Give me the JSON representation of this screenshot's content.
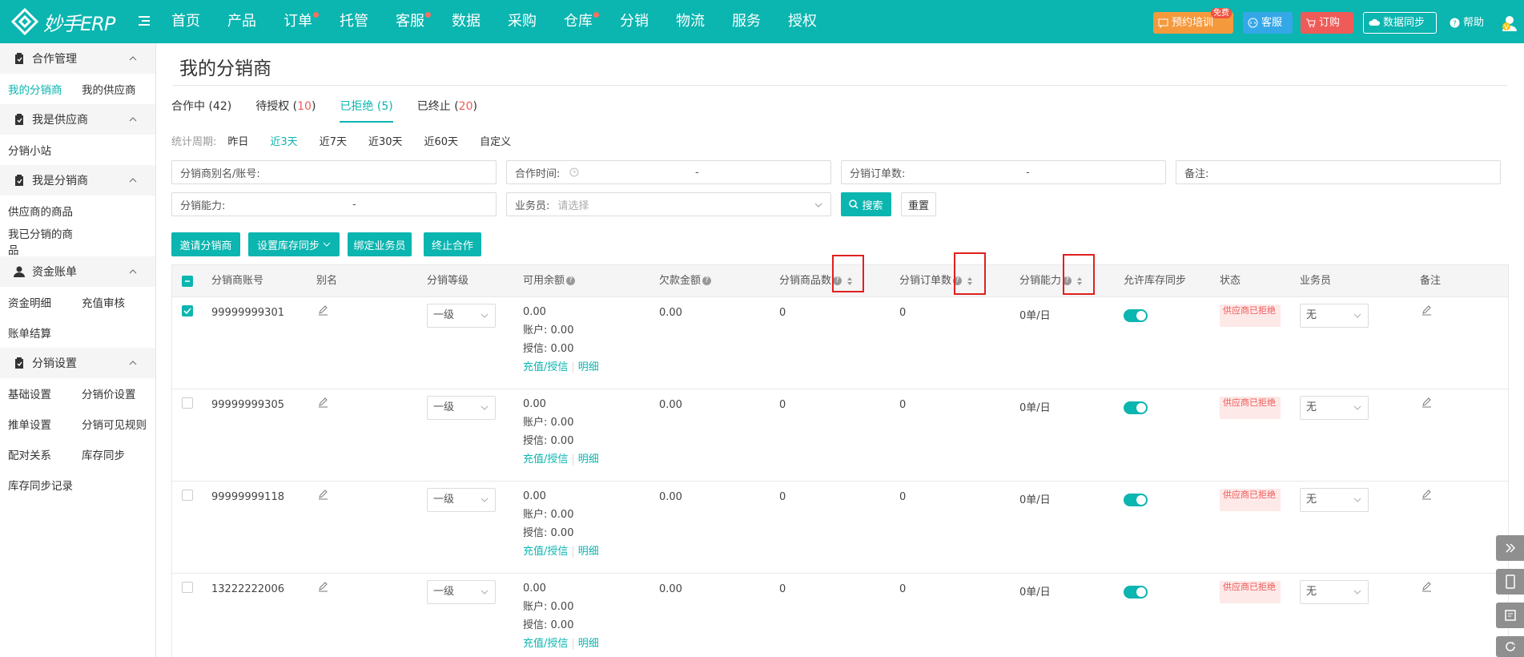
{
  "app": {
    "name": "妙手ERP",
    "brand_color": "#0bb5b0",
    "accent_red": "#ef5b58"
  },
  "nav": [
    {
      "label": "首页",
      "dot": false
    },
    {
      "label": "产品",
      "dot": false
    },
    {
      "label": "订单",
      "dot": true
    },
    {
      "label": "托管",
      "dot": false
    },
    {
      "label": "客服",
      "dot": true
    },
    {
      "label": "数据",
      "dot": false
    },
    {
      "label": "采购",
      "dot": false
    },
    {
      "label": "仓库",
      "dot": true
    },
    {
      "label": "分销",
      "dot": false
    },
    {
      "label": "物流",
      "dot": false
    },
    {
      "label": "服务",
      "dot": false
    },
    {
      "label": "授权",
      "dot": false
    }
  ],
  "topright": {
    "train": "预约培训",
    "free": "免费",
    "service": "客服",
    "buy": "订购",
    "sync": "数据同步",
    "help": "帮助",
    "avatar": "V"
  },
  "sidebar": {
    "groups": [
      {
        "title": "合作管理",
        "icon": "clipboard-icon",
        "rows": [
          [
            "我的分销商",
            "我的供应商"
          ]
        ]
      },
      {
        "title": "我是供应商",
        "icon": "clipboard-icon",
        "rows": [
          [
            "分销小站"
          ]
        ]
      },
      {
        "title": "我是分销商",
        "icon": "clipboard-icon",
        "rows": [
          [
            "供应商的商品"
          ],
          [
            "我已分销的商品"
          ]
        ]
      },
      {
        "title": "资金账单",
        "icon": "user-icon",
        "rows": [
          [
            "资金明细",
            "充值审核"
          ],
          [
            "账单结算"
          ]
        ]
      },
      {
        "title": "分销设置",
        "icon": "clipboard-icon",
        "rows": [
          [
            "基础设置",
            "分销价设置"
          ],
          [
            "推单设置",
            "分销可见规则"
          ],
          [
            "配对关系",
            "库存同步"
          ],
          [
            "库存同步记录"
          ]
        ]
      }
    ],
    "active": "我的分销商"
  },
  "page": {
    "title": "我的分销商"
  },
  "tabs": [
    {
      "label": "合作中",
      "count": "42",
      "active": false
    },
    {
      "label": "待授权",
      "count": "10",
      "active": false
    },
    {
      "label": "已拒绝",
      "count": "5",
      "active": true
    },
    {
      "label": "已终止",
      "count": "20",
      "active": false
    }
  ],
  "period": {
    "label": "统计周期:",
    "options": [
      "昨日",
      "近3天",
      "近7天",
      "近30天",
      "近60天",
      "自定义"
    ],
    "active": "近3天"
  },
  "filters": {
    "alias": "分销商别名/账号:",
    "coop_time": "合作时间:",
    "order_count": "分销订单数:",
    "remark": "备注:",
    "ability": "分销能力:",
    "salesman": "业务员:",
    "salesman_placeholder": "请选择",
    "dash": "-",
    "search": "搜索",
    "reset": "重置"
  },
  "actions": {
    "invite": "邀请分销商",
    "stock_sync": "设置库存同步",
    "bind": "绑定业务员",
    "terminate": "终止合作"
  },
  "columns": {
    "account": "分销商账号",
    "alias": "别名",
    "level": "分销等级",
    "balance": "可用余额",
    "debt": "欠款金额",
    "goods": "分销商品数",
    "orders": "分销订单数",
    "ability": "分销能力",
    "allow_sync": "允许库存同步",
    "status": "状态",
    "salesman": "业务员",
    "remark": "备注"
  },
  "row_labels": {
    "account_label": "账户:",
    "credit_label": "授信:",
    "recharge": "充值/授信",
    "detail": "明细"
  },
  "rows": [
    {
      "account": "99999999301",
      "checked": true,
      "level": "一级",
      "balance": "0.00",
      "acct": "0.00",
      "credit": "0.00",
      "debt": "0.00",
      "goods": "0",
      "orders": "0",
      "ability": "0单/日",
      "sync_on": true,
      "status": "供应商已拒绝",
      "salesman": "无"
    },
    {
      "account": "99999999305",
      "checked": false,
      "level": "一级",
      "balance": "0.00",
      "acct": "0.00",
      "credit": "0.00",
      "debt": "0.00",
      "goods": "0",
      "orders": "0",
      "ability": "0单/日",
      "sync_on": true,
      "status": "供应商已拒绝",
      "salesman": "无"
    },
    {
      "account": "99999999118",
      "checked": false,
      "level": "一级",
      "balance": "0.00",
      "acct": "0.00",
      "credit": "0.00",
      "debt": "0.00",
      "goods": "0",
      "orders": "0",
      "ability": "0单/日",
      "sync_on": true,
      "status": "供应商已拒绝",
      "salesman": "无"
    },
    {
      "account": "13222222006",
      "checked": false,
      "level": "一级",
      "balance": "0.00",
      "acct": "0.00",
      "credit": "0.00",
      "debt": "0.00",
      "goods": "0",
      "orders": "0",
      "ability": "0单/日",
      "sync_on": true,
      "status": "供应商已拒绝",
      "salesman": "无"
    }
  ]
}
